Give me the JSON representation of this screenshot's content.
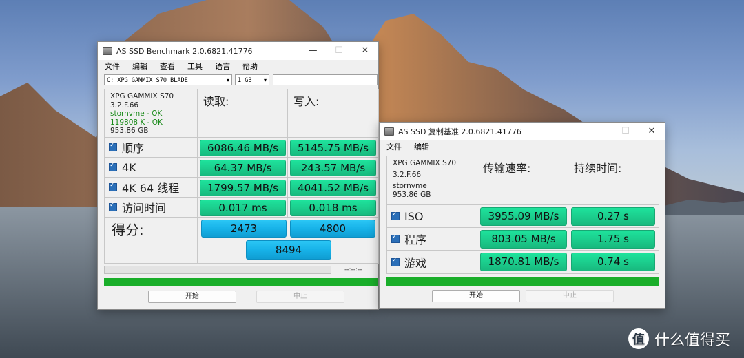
{
  "win1": {
    "title": "AS SSD Benchmark 2.0.6821.41776",
    "menu": [
      "文件",
      "编辑",
      "查看",
      "工具",
      "语言",
      "帮助"
    ],
    "drive": "C: XPG GAMMIX S70 BLADE",
    "size": "1 GB",
    "info": [
      "XPG GAMMIX S70",
      "3.2.F.66",
      "stornvme - OK",
      "119808 K - OK",
      "953.86 GB"
    ],
    "read_header": "读取:",
    "write_header": "写入:",
    "rows": [
      {
        "label": "顺序",
        "read": "6086.46 MB/s",
        "write": "5145.75 MB/s"
      },
      {
        "label": "4K",
        "read": "64.37 MB/s",
        "write": "243.57 MB/s"
      },
      {
        "label": "4K 64 线程",
        "read": "1799.57 MB/s",
        "write": "4041.52 MB/s"
      },
      {
        "label": "访问时间",
        "read": "0.017 ms",
        "write": "0.018 ms"
      }
    ],
    "score_label": "得分:",
    "score_read": "2473",
    "score_write": "4800",
    "score_total": "8494",
    "timer": "--:--:--",
    "progress": 1.0,
    "start": "开始",
    "abort": "中止"
  },
  "win2": {
    "title": "AS SSD 复制基准 2.0.6821.41776",
    "menu": [
      "文件",
      "编辑"
    ],
    "info": [
      "XPG GAMMIX S70",
      "3.2.F.66",
      "stornvme",
      "953.86 GB"
    ],
    "speed_header": "传输速率:",
    "time_header": "持续时间:",
    "rows": [
      {
        "label": "ISO",
        "speed": "3955.09 MB/s",
        "time": "0.27 s"
      },
      {
        "label": "程序",
        "speed": "803.05 MB/s",
        "time": "1.75 s"
      },
      {
        "label": "游戏",
        "speed": "1870.81 MB/s",
        "time": "0.74 s"
      }
    ],
    "progress": 1.0,
    "start": "开始",
    "abort": "中止"
  },
  "watermark": {
    "logo": "值",
    "text": "什么值得买"
  },
  "colors": {
    "value_green": "#1dd393",
    "score_blue": "#17b2e8",
    "progress_green": "#1aae2a"
  }
}
